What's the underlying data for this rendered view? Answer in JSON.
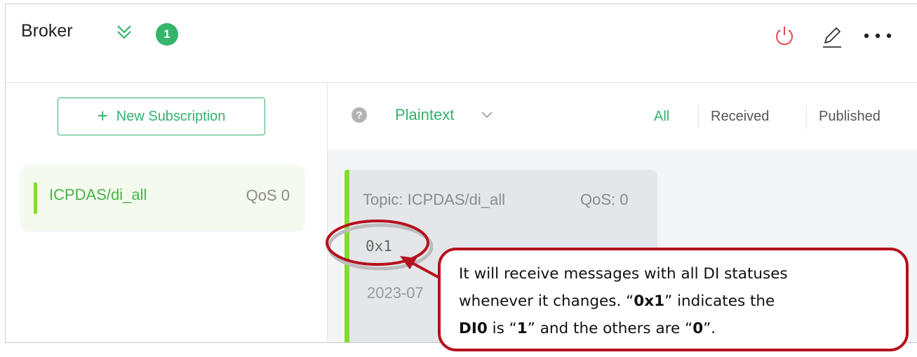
{
  "header": {
    "title": "Broker",
    "badge_count": "1"
  },
  "sidebar": {
    "new_subscription_label": "New Subscription",
    "subscriptions": [
      {
        "topic": "ICPDAS/di_all",
        "qos": "QoS 0",
        "color": "#84dc2e"
      }
    ]
  },
  "toolbar": {
    "help_icon_text": "?",
    "format": "Plaintext",
    "filters": [
      "All",
      "Received",
      "Published"
    ],
    "active_filter": "All"
  },
  "messages": [
    {
      "topic": "Topic: ICPDAS/di_all",
      "qos": "QoS: 0",
      "payload": "0x1",
      "time": "2023-07"
    }
  ],
  "callout": {
    "line1": "It will receive messages with all DI statuses",
    "line2_pre": "whenever it changes. “",
    "line2_bold": "0x1",
    "line2_post": "” indicates the",
    "line3_bold1": "DI0",
    "line3_mid1": " is “",
    "line3_bold2": "1",
    "line3_mid2": "” and the others are “",
    "line3_bold3": "0",
    "line3_end": "”."
  },
  "colors": {
    "accent": "#34b16d",
    "badge": "#35b46c",
    "power_icon": "#e5484d",
    "callout_border": "#b5111d"
  }
}
